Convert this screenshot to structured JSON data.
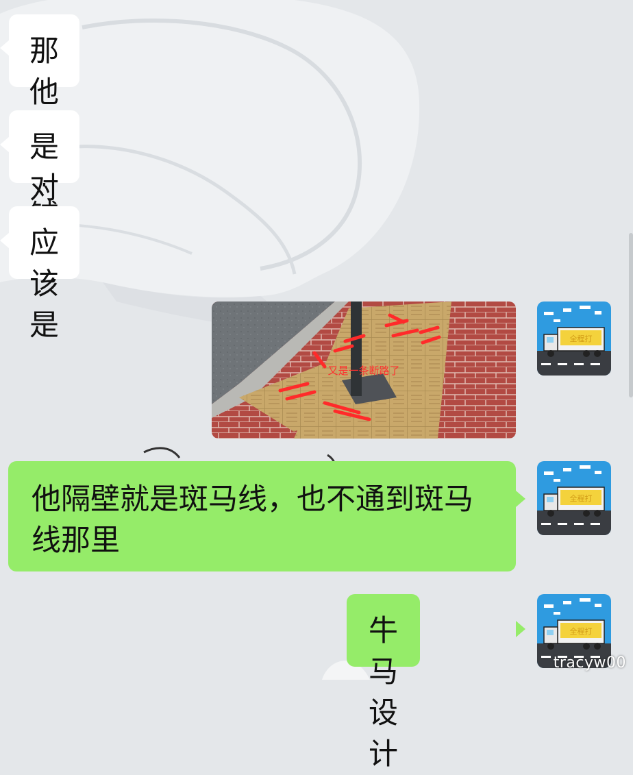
{
  "messages": [
    {
      "side": "in",
      "type": "text",
      "text": "那他这个铺的"
    },
    {
      "side": "in",
      "type": "text",
      "text": "是对的吗"
    },
    {
      "side": "in",
      "type": "text",
      "text": "应该是"
    },
    {
      "side": "out",
      "type": "image",
      "image": {
        "subject": "tactile paving around a pole with red marks",
        "caption": "又是一条断路了"
      }
    },
    {
      "side": "out",
      "type": "text",
      "lines": [
        "他隔壁就是斑马线，也不通到斑马",
        "线那里"
      ]
    },
    {
      "side": "out",
      "type": "text",
      "text": "牛马设计"
    }
  ],
  "avatar": {
    "truck_sign": "全程打"
  },
  "watermark": "tracyw00",
  "colors": {
    "chat_background": "#e4e7ea",
    "incoming_bubble": "#ffffff",
    "outgoing_bubble": "#95ec69",
    "avatar_sky": "#2f9be0",
    "avatar_road": "#3a3d42"
  }
}
